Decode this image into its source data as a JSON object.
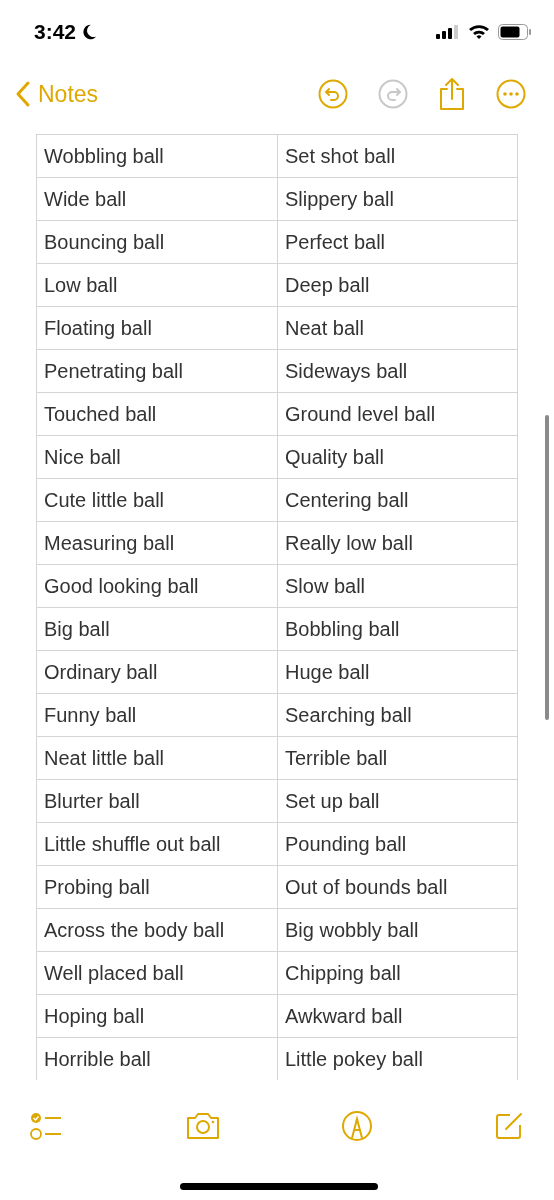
{
  "status_bar": {
    "time": "3:42"
  },
  "nav": {
    "back_label": "Notes",
    "undo_enabled": true,
    "redo_enabled": false
  },
  "table": {
    "rows": [
      [
        "Wobbling ball",
        "Set shot ball"
      ],
      [
        "Wide ball",
        "Slippery ball"
      ],
      [
        "Bouncing ball",
        "Perfect ball"
      ],
      [
        "Low ball",
        "Deep ball"
      ],
      [
        "Floating ball",
        "Neat ball"
      ],
      [
        "Penetrating ball",
        "Sideways ball"
      ],
      [
        "Touched ball",
        "Ground level ball"
      ],
      [
        "Nice ball",
        "Quality ball"
      ],
      [
        "Cute little ball",
        "Centering ball"
      ],
      [
        "Measuring ball",
        "Really low ball"
      ],
      [
        "Good looking ball",
        "Slow ball"
      ],
      [
        "Big ball",
        "Bobbling ball"
      ],
      [
        "Ordinary ball",
        "Huge ball"
      ],
      [
        "Funny ball",
        "Searching ball"
      ],
      [
        "Neat little ball",
        "Terrible ball"
      ],
      [
        "Blurter ball",
        "Set up ball"
      ],
      [
        "Little shuffle out ball",
        "Pounding ball"
      ],
      [
        "Probing ball",
        "Out of bounds ball"
      ],
      [
        "Across the body ball",
        "Big wobbly ball"
      ],
      [
        "Well placed ball",
        "Chipping ball"
      ],
      [
        "Hoping ball",
        "Awkward ball"
      ],
      [
        "Horrible ball",
        "Little pokey ball"
      ]
    ]
  }
}
